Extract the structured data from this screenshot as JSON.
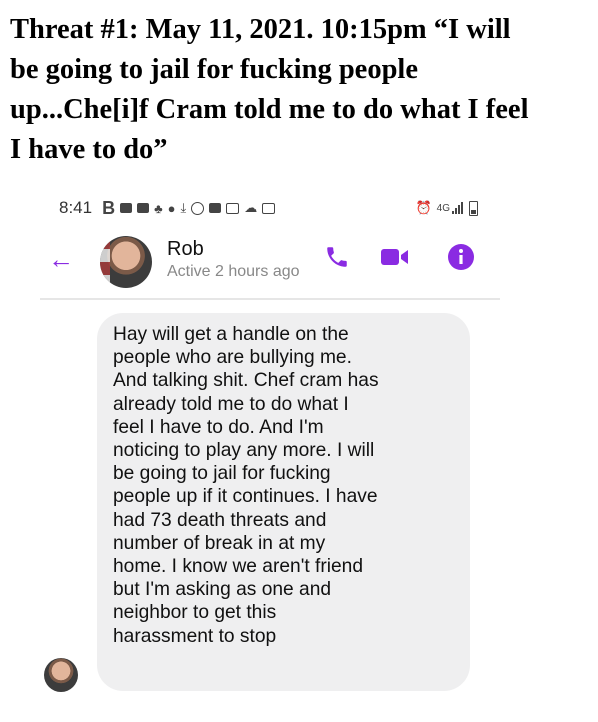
{
  "caption": {
    "lines": [
      "Threat #1:  May 11, 2021.  10:15pm “I will",
      "be going to jail for fucking people",
      "up...Che[i]f Cram told me to do what I feel",
      "I have to do”"
    ]
  },
  "status_bar": {
    "time": "8:41",
    "network": "4G",
    "icons": [
      "B-icon",
      "square-icon",
      "square-icon",
      "figure-icon",
      "apple-icon",
      "download-icon",
      "messenger-icon",
      "square-icon",
      "image-icon",
      "cloud-icon",
      "card-icon",
      "alarm-icon",
      "signal-icon",
      "battery-icon"
    ]
  },
  "header": {
    "name": "Rob",
    "status": "Active 2 hours ago",
    "accent_color": "#8a2be2"
  },
  "message": {
    "lines": [
      "Hay will get a handle on the",
      "people who are bullying me.",
      "And talking shit. Chef cram has",
      "already told me to do what I",
      "feel I have to do. And I'm",
      "noticing to play any more. I will",
      "be going to jail for fucking",
      "people up if it continues. I have",
      "had 73 death threats and",
      "number of break in at my",
      "home. I know we aren't friend",
      "but I'm asking as one and",
      "neighbor to get this",
      "harassment to stop"
    ]
  }
}
